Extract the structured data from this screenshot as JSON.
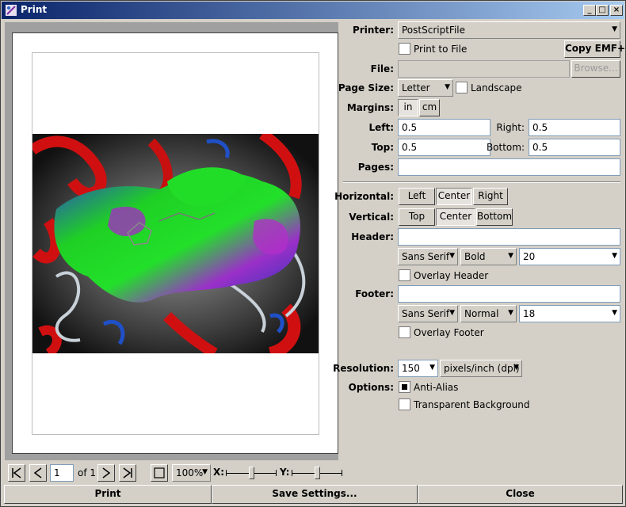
{
  "window": {
    "title": "Print",
    "minimize": "_",
    "maximize": "□",
    "close": "×"
  },
  "printer": {
    "label": "Printer:",
    "value": "PostScriptFile",
    "print_to_file": "Print to File",
    "copy_emf": "Copy EMF+"
  },
  "file": {
    "label": "File:",
    "value": "",
    "browse": "Browse..."
  },
  "page_size": {
    "label": "Page Size:",
    "value": "Letter",
    "landscape": "Landscape"
  },
  "margins": {
    "label": "Margins:",
    "unit_in": "in",
    "unit_cm": "cm",
    "left_label": "Left:",
    "left": "0.5",
    "right_label": "Right:",
    "right": "0.5",
    "top_label": "Top:",
    "top": "0.5",
    "bottom_label": "Bottom:",
    "bottom": "0.5"
  },
  "pages": {
    "label": "Pages:",
    "value": ""
  },
  "horizontal": {
    "label": "Horizontal:",
    "left": "Left",
    "center": "Center",
    "right": "Right",
    "selected": "Center"
  },
  "vertical": {
    "label": "Vertical:",
    "top": "Top",
    "center": "Center",
    "bottom": "Bottom",
    "selected": "Center"
  },
  "header": {
    "label": "Header:",
    "value": "",
    "font": "Sans Serif",
    "style": "Bold",
    "size": "20",
    "overlay": "Overlay Header"
  },
  "footer": {
    "label": "Footer:",
    "value": "",
    "font": "Sans Serif",
    "style": "Normal",
    "size": "18",
    "overlay": "Overlay Footer"
  },
  "resolution": {
    "label": "Resolution:",
    "value": "150",
    "unit": "pixels/inch (dpi)"
  },
  "options": {
    "label": "Options:",
    "anti_alias": "Anti-Alias",
    "anti_alias_checked": true,
    "transparent": "Transparent Background",
    "transparent_checked": false
  },
  "nav": {
    "page": "1",
    "of": "of 1",
    "zoom": "100%",
    "x_label": "X:",
    "y_label": "Y:",
    "x_slider": 0.5,
    "y_slider": 0.5
  },
  "buttons": {
    "print": "Print",
    "save": "Save Settings...",
    "close": "Close"
  },
  "icons": [
    "first-page-icon",
    "prev-page-icon",
    "next-page-icon",
    "last-page-icon",
    "fit-page-icon"
  ],
  "colors": {
    "titlebar_start": "#0a246a",
    "titlebar_end": "#a6caf0",
    "face": "#d4d0c8"
  }
}
